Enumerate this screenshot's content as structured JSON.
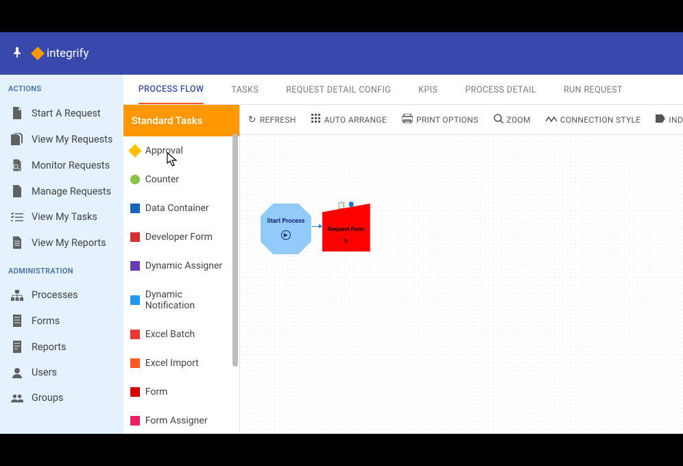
{
  "brand": {
    "name": "integrify"
  },
  "sidebar": {
    "sections": [
      {
        "title": "ACTIONS",
        "items": [
          {
            "icon": "doc-blank",
            "label": "Start A Request"
          },
          {
            "icon": "docs-stack",
            "label": "View My Requests"
          },
          {
            "icon": "doc-search",
            "label": "Monitor Requests"
          },
          {
            "icon": "doc-gear",
            "label": "Manage Requests"
          },
          {
            "icon": "checklist",
            "label": "View My Tasks"
          },
          {
            "icon": "doc-lines",
            "label": "View My Reports"
          }
        ]
      },
      {
        "title": "ADMINISTRATION",
        "items": [
          {
            "icon": "sitemap",
            "label": "Processes"
          },
          {
            "icon": "form",
            "label": "Forms"
          },
          {
            "icon": "report",
            "label": "Reports"
          },
          {
            "icon": "user",
            "label": "Users"
          },
          {
            "icon": "group",
            "label": "Groups"
          }
        ]
      }
    ]
  },
  "tabs": [
    {
      "label": "PROCESS FLOW",
      "active": true
    },
    {
      "label": "TASKS",
      "active": false
    },
    {
      "label": "REQUEST DETAIL CONFIG",
      "active": false
    },
    {
      "label": "KPIS",
      "active": false
    },
    {
      "label": "PROCESS DETAIL",
      "active": false
    },
    {
      "label": "RUN REQUEST",
      "active": false
    }
  ],
  "task_panel": {
    "header": "Standard Tasks",
    "items": [
      {
        "label": "Approval",
        "color": "#ffc107",
        "shape": "diamond"
      },
      {
        "label": "Counter",
        "color": "#8bc34a",
        "shape": "circle"
      },
      {
        "label": "Data Container",
        "color": "#1565c0",
        "shape": "square"
      },
      {
        "label": "Developer Form",
        "color": "#d32f2f",
        "shape": "square"
      },
      {
        "label": "Dynamic Assigner",
        "color": "#673ab7",
        "shape": "square"
      },
      {
        "label": "Dynamic Notification",
        "color": "#2196f3",
        "shape": "square"
      },
      {
        "label": "Excel Batch",
        "color": "#e53935",
        "shape": "square"
      },
      {
        "label": "Excel Import",
        "color": "#ff5722",
        "shape": "square"
      },
      {
        "label": "Form",
        "color": "#d50000",
        "shape": "square"
      },
      {
        "label": "Form Assigner",
        "color": "#e91e63",
        "shape": "square"
      }
    ]
  },
  "toolbar": [
    {
      "icon": "refresh",
      "label": "REFRESH"
    },
    {
      "icon": "grid",
      "label": "AUTO ARRANGE"
    },
    {
      "icon": "print",
      "label": "PRINT OPTIONS"
    },
    {
      "icon": "zoom",
      "label": "ZOOM"
    },
    {
      "icon": "line",
      "label": "CONNECTION STYLE"
    },
    {
      "icon": "tag",
      "label": "IND"
    }
  ],
  "canvas": {
    "nodes": {
      "start": {
        "label": "Start Process"
      },
      "form": {
        "label": "Request Form"
      }
    }
  }
}
